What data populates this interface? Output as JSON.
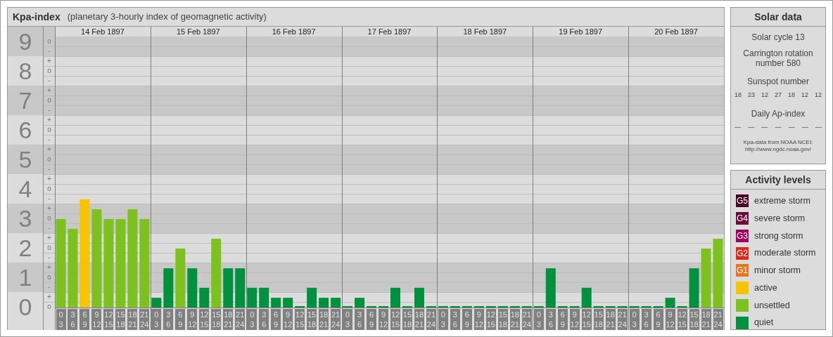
{
  "kp_panel": {
    "title": "Kpa-index",
    "subtitle": "(planetary 3-hourly index of geomagnetic activity)",
    "days": [
      "14 Feb 1897",
      "15 Feb 1897",
      "16 Feb 1897",
      "17 Feb 1897",
      "18 Feb 1897",
      "19 Feb 1897",
      "20 Feb 1897"
    ],
    "sub_tick_labels": [
      "o",
      "-",
      "+",
      "o",
      "-",
      "+",
      "o",
      "-",
      "+",
      "o",
      "-",
      "+",
      "o",
      "-",
      "+",
      "o",
      "-",
      "+",
      "o",
      "-",
      "+",
      "o",
      "-",
      "+",
      "o",
      "-",
      "+",
      "o"
    ],
    "chart_data": {
      "type": "bar",
      "grid": true,
      "ylim": [
        0,
        9.5
      ],
      "yticks": [
        0,
        1,
        2,
        3,
        4,
        5,
        6,
        7,
        8,
        9
      ],
      "categories": [
        "0\n3",
        "3\n6",
        "6\n9",
        "9\n12",
        "12\n15",
        "15\n18",
        "18\n21",
        "21\n24",
        "0\n3",
        "3\n6",
        "6\n9",
        "9\n12",
        "12\n15",
        "15\n18",
        "18\n21",
        "21\n24",
        "0\n3",
        "3\n6",
        "6\n9",
        "9\n12",
        "12\n15",
        "15\n18",
        "18\n21",
        "21\n24",
        "0\n3",
        "3\n6",
        "6\n9",
        "9\n12",
        "12\n15",
        "15\n18",
        "18\n21",
        "21\n24",
        "0\n3",
        "3\n6",
        "6\n9",
        "9\n12",
        "12\n15",
        "15\n18",
        "18\n21",
        "21\n24",
        "0\n3",
        "3\n6",
        "6\n9",
        "9\n12",
        "12\n15",
        "15\n18",
        "18\n21",
        "21\n24",
        "0\n3",
        "3\n6",
        "6\n9",
        "9\n12",
        "12\n15",
        "15\n18",
        "18\n21",
        "21\n24"
      ],
      "series": [
        {
          "color": "#00913f",
          "values": [
            null,
            null,
            null,
            null,
            null,
            null,
            null,
            null,
            0.33,
            1.33,
            null,
            1.33,
            0.67,
            null,
            1.33,
            1.33,
            0.67,
            0.67,
            0.33,
            0.33,
            0,
            0.67,
            0.33,
            0.33,
            0,
            0.33,
            0,
            0,
            0.67,
            0,
            0.67,
            0,
            0,
            0,
            0,
            0,
            0,
            0,
            0,
            0,
            0,
            1.33,
            0,
            0,
            0.67,
            0,
            0,
            0,
            0,
            0,
            0,
            0.33,
            0,
            1.33,
            null,
            null
          ]
        },
        {
          "color": "#7dc11f",
          "values": [
            3,
            2.67,
            null,
            3.33,
            3,
            3,
            3.33,
            3,
            null,
            null,
            2,
            null,
            null,
            2.33,
            null,
            null,
            null,
            null,
            null,
            null,
            null,
            null,
            null,
            null,
            null,
            null,
            null,
            null,
            null,
            null,
            null,
            null,
            null,
            null,
            null,
            null,
            null,
            null,
            null,
            null,
            null,
            null,
            null,
            null,
            null,
            null,
            null,
            null,
            null,
            null,
            null,
            null,
            null,
            null,
            2,
            2.33
          ]
        },
        {
          "color": "#f7c500",
          "values": [
            null,
            null,
            3.67,
            null,
            null,
            null,
            null,
            null,
            null,
            null,
            null,
            null,
            null,
            null,
            null,
            null,
            null,
            null,
            null,
            null,
            null,
            null,
            null,
            null,
            null,
            null,
            null,
            null,
            null,
            null,
            null,
            null,
            null,
            null,
            null,
            null,
            null,
            null,
            null,
            null,
            null,
            null,
            null,
            null,
            null,
            null,
            null,
            null,
            null,
            null,
            null,
            null,
            null,
            null,
            null,
            null
          ]
        }
      ]
    }
  },
  "solar_data": {
    "title": "Solar data",
    "solar_cycle": "Solar cycle 13",
    "carrington_rotation": "Carrington rotation number 580",
    "sunspot_label": "Sunspot number",
    "sunspot_numbers": [
      "18",
      "23",
      "12",
      "27",
      "18",
      "12",
      "12"
    ],
    "ap_label": "Daily Ap-index",
    "ap_values": [
      "—",
      "—",
      "—",
      "—",
      "—",
      "—",
      "—"
    ],
    "source_note": "Kpa-data from NOAA NCEI: http://www.ngdc.noaa.gov/"
  },
  "activity_levels": {
    "title": "Activity levels",
    "items": [
      {
        "badge": "G5",
        "label": "extreme storm",
        "color": "#4a0026"
      },
      {
        "badge": "G4",
        "label": "severe storm",
        "color": "#6c0a3a"
      },
      {
        "badge": "G3",
        "label": "strong storm",
        "color": "#a1005b"
      },
      {
        "badge": "G2",
        "label": "moderate storm",
        "color": "#d92a1c"
      },
      {
        "badge": "G1",
        "label": "minor storm",
        "color": "#e8761c"
      },
      {
        "label": "active",
        "color": "#f7c500"
      },
      {
        "label": "unsettled",
        "color": "#7dc11f"
      },
      {
        "label": "quiet",
        "color": "#00913f"
      }
    ]
  }
}
